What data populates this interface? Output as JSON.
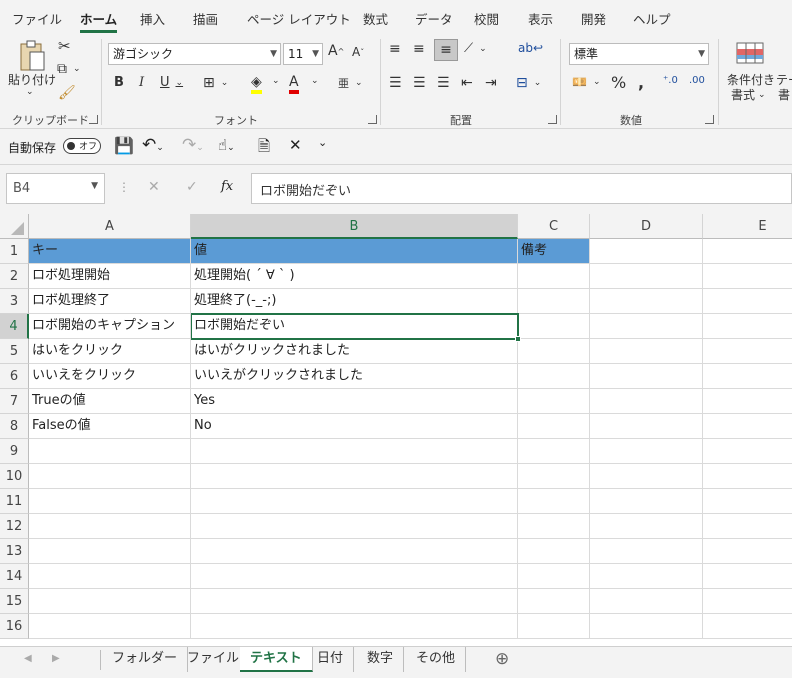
{
  "menu_tabs": [
    "ファイル",
    "ホーム",
    "挿入",
    "描画",
    "ページ レイアウト",
    "数式",
    "データ",
    "校閲",
    "表示",
    "開発",
    "ヘルプ"
  ],
  "active_tab": "ホーム",
  "ribbon": {
    "clipboard": {
      "paste_label": "貼り付け",
      "group_label": "クリップボード"
    },
    "font": {
      "font_name": "游ゴシック",
      "font_size": "11",
      "group_label": "フォント"
    },
    "alignment": {
      "group_label": "配置"
    },
    "number": {
      "format": "標準",
      "group_label": "数値"
    },
    "styles": {
      "conditional_label_1": "条件付き",
      "conditional_label_2": "書式",
      "table_label_1": "テー",
      "table_label_2": "書"
    }
  },
  "qat": {
    "autosave_label": "自動保存",
    "toggle_label": "オフ"
  },
  "formula_bar": {
    "name_box": "B4",
    "content": "ロボ開始だぞい",
    "fx": "fx"
  },
  "columns": [
    "A",
    "B",
    "C",
    "D",
    "E"
  ],
  "selected_column": "B",
  "selected_row": 4,
  "rows": [
    {
      "n": "1",
      "a": "キー",
      "b": "値",
      "c": "備考"
    },
    {
      "n": "2",
      "a": "ロボ処理開始",
      "b": "処理開始( ´ ∀ ` )",
      "c": ""
    },
    {
      "n": "3",
      "a": "ロボ処理終了",
      "b": "処理終了(-_-;)",
      "c": ""
    },
    {
      "n": "4",
      "a": "ロボ開始のキャプション",
      "b": "ロボ開始だぞい",
      "c": ""
    },
    {
      "n": "5",
      "a": "はいをクリック",
      "b": "はいがクリックされました",
      "c": ""
    },
    {
      "n": "6",
      "a": "いいえをクリック",
      "b": "いいえがクリックされました",
      "c": ""
    },
    {
      "n": "7",
      "a": "Trueの値",
      "b": "Yes",
      "c": ""
    },
    {
      "n": "8",
      "a": "Falseの値",
      "b": "No",
      "c": ""
    },
    {
      "n": "9",
      "a": "",
      "b": "",
      "c": ""
    },
    {
      "n": "10",
      "a": "",
      "b": "",
      "c": ""
    },
    {
      "n": "11",
      "a": "",
      "b": "",
      "c": ""
    },
    {
      "n": "12",
      "a": "",
      "b": "",
      "c": ""
    },
    {
      "n": "13",
      "a": "",
      "b": "",
      "c": ""
    },
    {
      "n": "14",
      "a": "",
      "b": "",
      "c": ""
    },
    {
      "n": "15",
      "a": "",
      "b": "",
      "c": ""
    },
    {
      "n": "16",
      "a": "",
      "b": "",
      "c": ""
    }
  ],
  "sheet_tabs": [
    "フォルダー",
    "ファイル",
    "テキスト",
    "日付",
    "数字",
    "その他"
  ],
  "active_sheet": "テキスト",
  "colors": {
    "accent": "#217346",
    "header_fill": "#5b9bd5"
  }
}
